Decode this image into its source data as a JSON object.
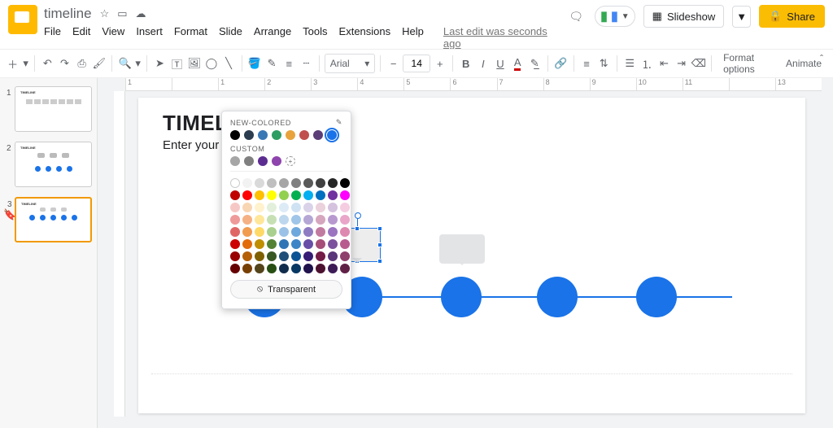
{
  "header": {
    "doc_title": "timeline",
    "star_icon": "☆",
    "move_icon": "▭",
    "cloud_icon": "☁",
    "edit_status": "Last edit was seconds ago",
    "comment_icon": "🗨",
    "slideshow_label": "Slideshow",
    "slideshow_icon": "▦",
    "share_label": "Share",
    "share_icon": "🔒"
  },
  "menu": {
    "items": [
      "File",
      "Edit",
      "View",
      "Insert",
      "Format",
      "Slide",
      "Arrange",
      "Tools",
      "Extensions",
      "Help"
    ]
  },
  "toolbar": {
    "font": "Arial",
    "size": "14",
    "format_options": "Format options",
    "animate": "Animate"
  },
  "filmstrip": {
    "slides": [
      {
        "num": "1",
        "title": "TIMELINE"
      },
      {
        "num": "2",
        "title": "TIMELINE"
      },
      {
        "num": "3",
        "title": "TIMELINE",
        "selected": true
      }
    ]
  },
  "ruler": {
    "marks": [
      "1",
      "",
      "1",
      "2",
      "3",
      "4",
      "5",
      "6",
      "7",
      "8",
      "9",
      "10",
      "11",
      "",
      "13"
    ]
  },
  "slide": {
    "title": "TIMELINE",
    "subtitle": "Enter your subtitle here"
  },
  "colorpop": {
    "section1": "NEW-COLORED",
    "section2": "CUSTOM",
    "pencil": "✎",
    "transparent_label": "Transparent",
    "transparent_icon": "⦸",
    "new_colored": [
      "#000000",
      "#2b3d4f",
      "#3a78b5",
      "#2e9d63",
      "#e8a33d",
      "#c0504d",
      "#5b3d77",
      "#1a73e8"
    ],
    "new_colored_selected": 7,
    "custom": [
      "#a6a6a6",
      "#808080",
      "#5c2d91",
      "#8e44ad"
    ],
    "grid": [
      [
        "#ffffff",
        "#f2f2f2",
        "#d9d9d9",
        "#bfbfbf",
        "#a6a6a6",
        "#808080",
        "#595959",
        "#404040",
        "#262626",
        "#000000"
      ],
      [
        "#c00000",
        "#ff0000",
        "#ffc000",
        "#ffff00",
        "#92d050",
        "#00b050",
        "#00b0f0",
        "#0070c0",
        "#7030a0",
        "#ff00ff"
      ],
      [
        "#f6c8c5",
        "#f8d6b3",
        "#fff2cc",
        "#e2efda",
        "#ddebf7",
        "#cfe2f3",
        "#d9d2e9",
        "#ead1dc",
        "#d5c2df",
        "#f4cde1"
      ],
      [
        "#ef9a9a",
        "#f5b183",
        "#ffe699",
        "#c6e0b4",
        "#bdd7ee",
        "#9fc5e8",
        "#b4a7d6",
        "#d5a6bd",
        "#b799cf",
        "#e9a6c9"
      ],
      [
        "#e06666",
        "#f19c4f",
        "#ffd966",
        "#a9d08e",
        "#9bc2e6",
        "#6fa8dc",
        "#8e7cc3",
        "#c27ba0",
        "#9b75c0",
        "#de89b0"
      ],
      [
        "#cc0000",
        "#e26b0a",
        "#bf8f00",
        "#548235",
        "#2f75b5",
        "#3d85c6",
        "#674ea7",
        "#a64d79",
        "#7b519d",
        "#b85c8f"
      ],
      [
        "#990000",
        "#b45f06",
        "#7f6000",
        "#385723",
        "#1f4e78",
        "#0b5394",
        "#351c75",
        "#741b47",
        "#5a3579",
        "#8f3f6c"
      ],
      [
        "#660000",
        "#783f04",
        "#54441a",
        "#274e13",
        "#102c4c",
        "#073763",
        "#20124d",
        "#4c1130",
        "#3d1b56",
        "#602045"
      ]
    ]
  }
}
